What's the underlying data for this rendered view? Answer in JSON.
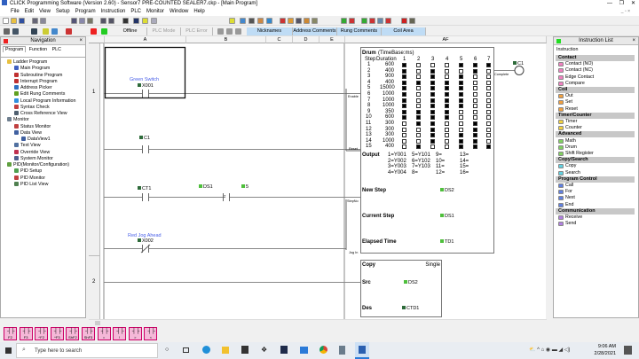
{
  "window": {
    "title": "CLICK Programming Software (Version 2.60) - Sensor7 PRE-COUNTED SEALER7.ckp - [Main Program]"
  },
  "menu": [
    "File",
    "Edit",
    "View",
    "Setup",
    "Program",
    "Instruction",
    "PLC",
    "Monitor",
    "Window",
    "Help"
  ],
  "toolbar": {
    "offline": "Offline",
    "plc_mode": "PLC Mode",
    "plc_error": "PLC Error",
    "nicknames": "Nicknames",
    "address_comments": "Address Comments",
    "rung_comments": "Rung Comments",
    "coil_area": "Coil Area"
  },
  "navigation": {
    "title": "Navigation",
    "tabs": [
      "Program",
      "Function",
      "PLC"
    ],
    "tree": [
      {
        "label": "Ladder Program",
        "level": 0,
        "color": "#e8c040"
      },
      {
        "label": "Main Program",
        "level": 1,
        "color": "#4060c0"
      },
      {
        "label": "Subroutine Program",
        "level": 1,
        "color": "#c03030"
      },
      {
        "label": "Interrupt Program",
        "level": 1,
        "color": "#c03030"
      },
      {
        "label": "Address Picker",
        "level": 1,
        "color": "#3070c0"
      },
      {
        "label": "Edit Rung Comments",
        "level": 1,
        "color": "#60a020"
      },
      {
        "label": "Local Program Information",
        "level": 1,
        "color": "#3090e0"
      },
      {
        "label": "Syntax Check",
        "level": 1,
        "color": "#c04040"
      },
      {
        "label": "Cross Reference View",
        "level": 1,
        "color": "#506070"
      },
      {
        "label": "Monitor",
        "level": 0,
        "color": "#708090"
      },
      {
        "label": "Status Monitor",
        "level": 1,
        "color": "#c04040"
      },
      {
        "label": "Data View",
        "level": 1,
        "color": "#4060a0"
      },
      {
        "label": "DataView1",
        "level": 2,
        "color": "#4060a0"
      },
      {
        "label": "Text View",
        "level": 1,
        "color": "#5070a0"
      },
      {
        "label": "Override View",
        "level": 1,
        "color": "#c03050"
      },
      {
        "label": "System Monitor",
        "level": 1,
        "color": "#506090"
      },
      {
        "label": "PID(Monitor/Configuration)",
        "level": 0,
        "color": "#60a040"
      },
      {
        "label": "PID Setup",
        "level": 1,
        "color": "#50a050"
      },
      {
        "label": "PID Monitor",
        "level": 1,
        "color": "#c04040"
      },
      {
        "label": "PID List View",
        "level": 1,
        "color": "#508050"
      }
    ]
  },
  "ladder": {
    "columns": [
      "A",
      "B",
      "C",
      "D",
      "E",
      "AF"
    ],
    "rungs": [
      "1",
      "2"
    ],
    "contacts": {
      "x001": {
        "nick": "Green Switch",
        "addr": "X001"
      },
      "c1": {
        "addr": "C1"
      },
      "ct1": {
        "addr": "CT1"
      },
      "ds1": {
        "addr": "DS1"
      },
      "compare_op": "≠",
      "const": "5",
      "x002": {
        "nick": "Red Jog Ahead",
        "addr": "X002"
      }
    },
    "inputs": [
      "Enable",
      "Reset",
      "StepNo",
      "Jog In"
    ],
    "drum": {
      "title": "Drum",
      "timebase": "(TimeBase:ms)",
      "step_label": "Step",
      "duration_label": "Duration",
      "columns": [
        "1",
        "2",
        "3",
        "4",
        "5",
        "6",
        "7"
      ],
      "steps": [
        {
          "n": "1",
          "d": "600",
          "p": "1000111"
        },
        {
          "n": "2",
          "d": "400",
          "p": "1010010"
        },
        {
          "n": "3",
          "d": "900",
          "p": "1010100"
        },
        {
          "n": "4",
          "d": "400",
          "p": "1111100"
        },
        {
          "n": "5",
          "d": "15000",
          "p": "1011100"
        },
        {
          "n": "6",
          "d": "1000",
          "p": "1011100"
        },
        {
          "n": "7",
          "d": "1000",
          "p": "1011100"
        },
        {
          "n": "8",
          "d": "1000",
          "p": "1011100"
        },
        {
          "n": "9",
          "d": "350",
          "p": "1111000"
        },
        {
          "n": "10",
          "d": "600",
          "p": "1111000"
        },
        {
          "n": "11",
          "d": "300",
          "p": "0110010"
        },
        {
          "n": "12",
          "d": "300",
          "p": "0010010"
        },
        {
          "n": "13",
          "d": "300",
          "p": "0010110"
        },
        {
          "n": "14",
          "d": "1000",
          "p": "0010110"
        },
        {
          "n": "15",
          "d": "400",
          "p": "0100111"
        }
      ],
      "output_label": "Output",
      "outputs": [
        [
          "1=Y001",
          "5=Y101",
          "9=",
          "13="
        ],
        [
          "2=Y002",
          "6=Y102",
          "10=",
          "14="
        ],
        [
          "3=Y003",
          "7=Y103",
          "11=",
          "15="
        ],
        [
          "4=Y004",
          "8=",
          "12=",
          "16="
        ]
      ],
      "new_step_label": "New Step",
      "new_step": "DS2",
      "current_step_label": "Current Step",
      "current_step": "DS1",
      "elapsed_label": "Elapsed Time",
      "elapsed": "TD1",
      "complete_label": "Complete",
      "complete_coil": "C1"
    },
    "copy": {
      "title": "Copy",
      "mode": "Single",
      "src_label": "Src",
      "src": "DS2",
      "des_label": "Des",
      "des": "CTD1"
    }
  },
  "instruction_list": {
    "title": "Instruction List",
    "tab": "Instruction",
    "groups": [
      {
        "name": "Contact",
        "color": "#f080c0",
        "items": [
          "Contact (NO)",
          "Contact (NC)",
          "Edge Contact",
          "Compare"
        ]
      },
      {
        "name": "Coil",
        "color": "#f0a040",
        "items": [
          "Out",
          "Set",
          "Reset"
        ]
      },
      {
        "name": "Timer/Counter",
        "color": "#f0d040",
        "items": [
          "Timer",
          "Counter"
        ]
      },
      {
        "name": "Advanced",
        "color": "#80d060",
        "items": [
          "Math",
          "Drum",
          "Shift Register"
        ]
      },
      {
        "name": "Copy/Search",
        "color": "#60d0e0",
        "items": [
          "Copy",
          "Search"
        ]
      },
      {
        "name": "Program Control",
        "color": "#6080e0",
        "items": [
          "Call",
          "For",
          "Next",
          "End"
        ]
      },
      {
        "name": "Communication",
        "color": "#b080e0",
        "items": [
          "Receive",
          "Send"
        ]
      }
    ]
  },
  "function_keys": [
    "F2",
    "F3",
    "^F2",
    "^F3",
    "ShF2",
    "ShF3",
    "=",
    "!",
    ">",
    "<"
  ],
  "taskbar": {
    "search_placeholder": "Type here to search",
    "time": "9:06 AM",
    "date": "2/28/2021"
  }
}
